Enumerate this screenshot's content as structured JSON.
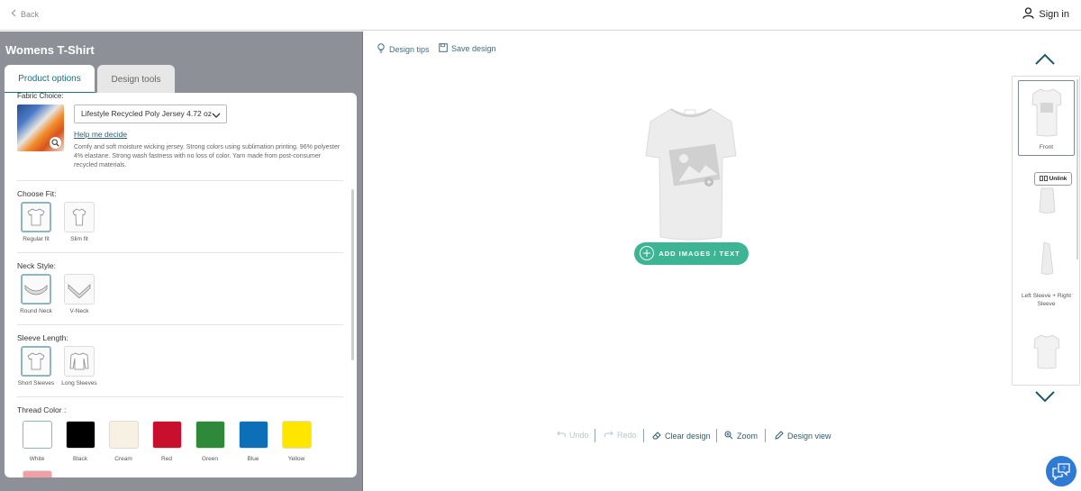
{
  "topbar": {
    "back_label": "Back",
    "signin_label": "Sign in"
  },
  "product": {
    "title": "Womens T-Shirt"
  },
  "tabs": [
    {
      "label": "Product options"
    },
    {
      "label": "Design tools"
    }
  ],
  "fabric": {
    "label": "Fabric Choice:",
    "selected": "Lifestyle Recycled Poly Jersey 4.72 oz",
    "help_link": "Help me decide",
    "description": "Comfy and soft moisture wicking jersey. Strong colors using sublimation printing. 96% polyester 4% elastane. Strong wash fastness with no loss of color. Yarn made from post-consumer recycled materials."
  },
  "fit": {
    "label": "Choose Fit:",
    "options": [
      {
        "label": "Regular fit"
      },
      {
        "label": "Slim fit"
      }
    ]
  },
  "neck": {
    "label": "Neck Style:",
    "options": [
      {
        "label": "Round Neck"
      },
      {
        "label": "V-Neck"
      }
    ]
  },
  "sleeve": {
    "label": "Sleeve Length:",
    "options": [
      {
        "label": "Short Sleeves"
      },
      {
        "label": "Long Sleeves"
      }
    ]
  },
  "thread": {
    "label": "Thread Color :",
    "colors": [
      {
        "label": "White",
        "hex": "#ffffff"
      },
      {
        "label": "Black",
        "hex": "#000000"
      },
      {
        "label": "Cream",
        "hex": "#f7f1e4"
      },
      {
        "label": "Red",
        "hex": "#c8102e"
      },
      {
        "label": "Green",
        "hex": "#2e8a3a"
      },
      {
        "label": "Blue",
        "hex": "#0d6fb8"
      },
      {
        "label": "Yellow",
        "hex": "#ffe600"
      },
      {
        "label": "",
        "hex": "#f2a0a8"
      }
    ]
  },
  "canvas": {
    "design_tips": "Design tips",
    "save_design": "Save design",
    "add_button": "ADD IMAGES / TEXT",
    "accent": "#3db594"
  },
  "bottom_tools": {
    "undo": "Undo",
    "redo": "Redo",
    "clear": "Clear design",
    "zoom": "Zoom",
    "design_view": "Design view"
  },
  "views": {
    "front": "Front",
    "unlink": "Unlink",
    "sleeves": "Left Sleeve + Right Sleeve"
  }
}
